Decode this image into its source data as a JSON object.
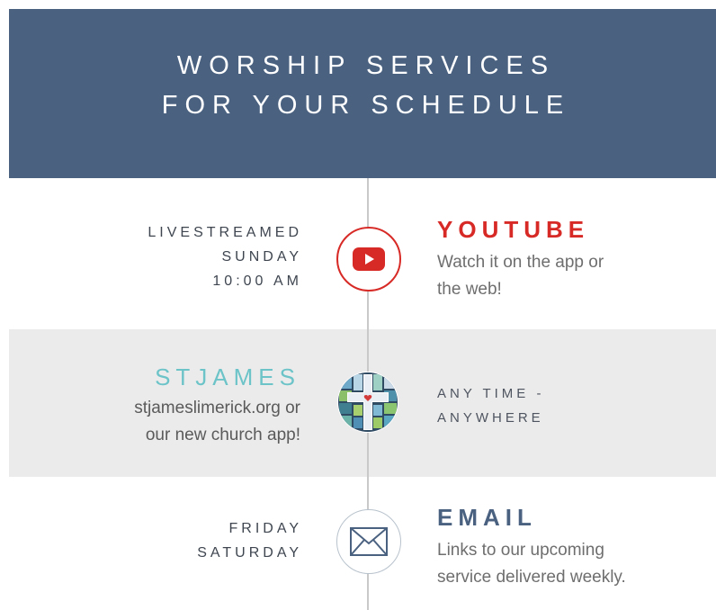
{
  "header": {
    "line1": "WORSHIP SERVICES",
    "line2": "FOR YOUR SCHEDULE"
  },
  "rows": [
    {
      "left_lines": [
        "LIVESTREAMED",
        "SUNDAY",
        "10:00 AM"
      ],
      "icon": "youtube-icon",
      "title": "YOUTUBE",
      "title_color": "#d72a26",
      "text_lines": [
        "Watch it on the app or",
        "the web!"
      ]
    },
    {
      "left_title": "STJAMES",
      "left_title_color": "#6cc3c8",
      "left_text_lines": [
        "stjameslimerick.org or",
        "our new church app!"
      ],
      "icon": "church-cross-icon",
      "right_lines": [
        "ANY TIME -",
        "ANYWHERE"
      ]
    },
    {
      "left_lines": [
        "FRIDAY",
        "SATURDAY"
      ],
      "icon": "envelope-icon",
      "title": "EMAIL",
      "title_color": "#4a6180",
      "text_lines": [
        "Links to our upcoming",
        "service delivered weekly."
      ]
    }
  ],
  "colors": {
    "header_bg": "#4a6180",
    "gray_band": "#ebebeb",
    "youtube_red": "#d72a26",
    "teal": "#6cc3c8"
  }
}
